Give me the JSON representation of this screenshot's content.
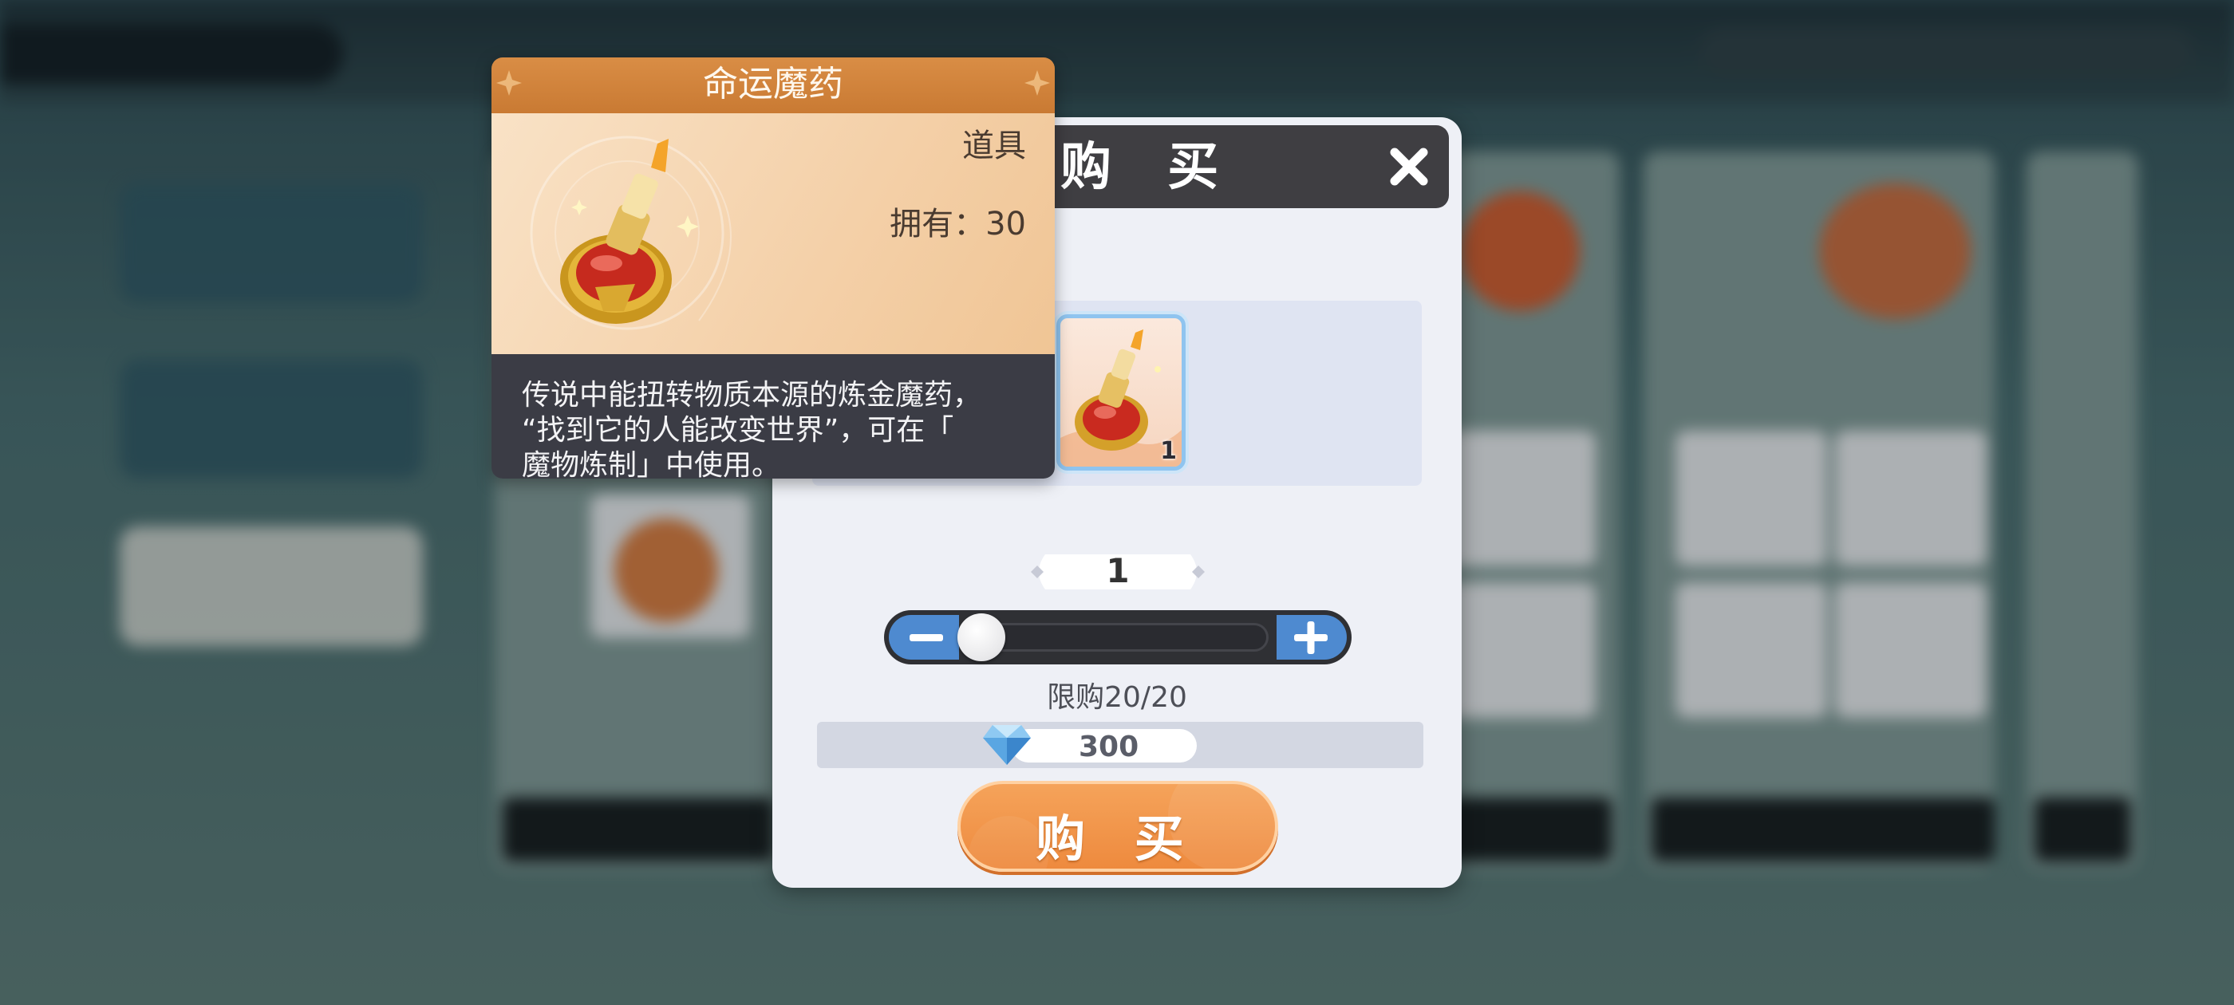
{
  "tooltip": {
    "item_name": "命运魔药",
    "item_type": "道具",
    "owned": "拥有：30",
    "description_lines": [
      "传说中能扭转物质本源的炼金魔药，",
      "“找到它的人能改变世界”，可在「",
      "魔物炼制」中使用。"
    ]
  },
  "dialog": {
    "title": "购 买",
    "item_count": "1",
    "quantity": "1",
    "purchase_limit": "限购20/20",
    "price": "300",
    "buy_label": "购 买"
  },
  "slider": {
    "min": 1,
    "max": 20,
    "value": 1
  },
  "colors": {
    "accent_orange": "#ee8a3e",
    "slider_blue": "#4e8ad0",
    "dialog_header": "#3f3e42",
    "tooltip_header": "#d98d45"
  },
  "icons": [
    "close-icon",
    "minus-icon",
    "plus-icon",
    "gem-icon",
    "potion-icon"
  ]
}
